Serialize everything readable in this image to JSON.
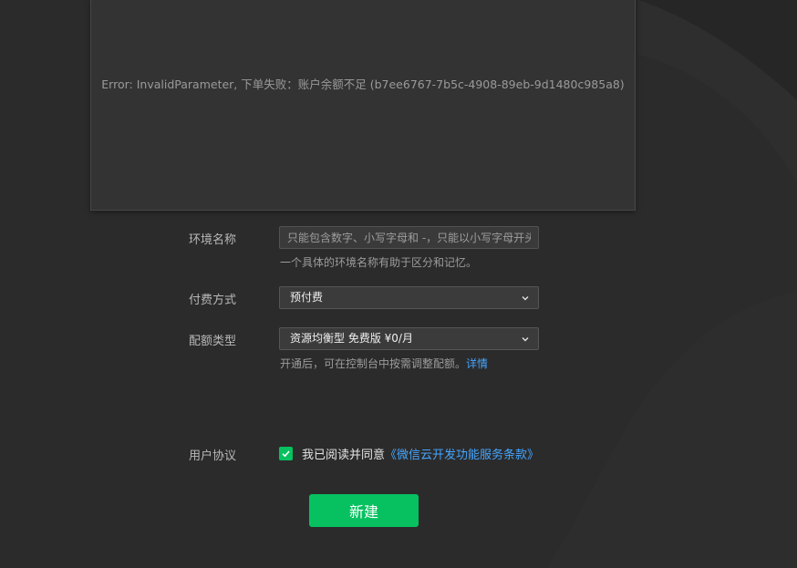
{
  "error": {
    "message": "Error: InvalidParameter, 下单失败：账户余额不足 (b7ee6767-7b5c-4908-89eb-9d1480c985a8)"
  },
  "form": {
    "env_name": {
      "label": "环境名称",
      "placeholder": "只能包含数字、小写字母和 -，只能以小写字母开头",
      "value": "",
      "hint": "一个具体的环境名称有助于区分和记忆。"
    },
    "payment": {
      "label": "付费方式",
      "selected": "预付费"
    },
    "quota": {
      "label": "配额类型",
      "selected": "资源均衡型 免费版 ¥0/月",
      "hint": "开通后，可在控制台中按需调整配额。",
      "hint_link": "详情"
    },
    "agreement": {
      "label": "用户协议",
      "checked": true,
      "text": "我已阅读并同意",
      "link": "《微信云开发功能服务条款》"
    }
  },
  "submit_label": "新建",
  "colors": {
    "background": "#2b2b2b",
    "panel": "#333333",
    "accent_green": "#07c160",
    "link_blue": "#45a5ff"
  },
  "icons": {
    "select_arrow": "chevron-down-icon",
    "checkbox_mark": "check-icon"
  }
}
